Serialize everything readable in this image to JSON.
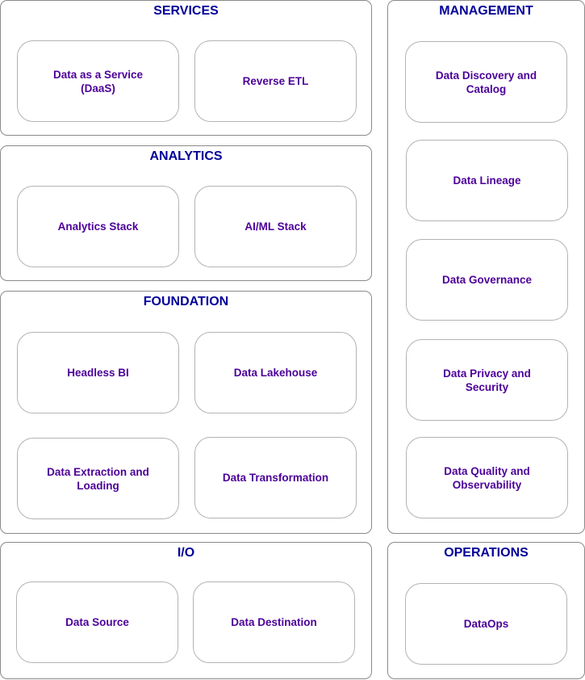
{
  "colors": {
    "group_title": "#000099",
    "card_text": "#4c0099",
    "group_border": "#8a8a8a",
    "card_border": "#b3b3b3"
  },
  "groups": {
    "services": {
      "title": "SERVICES",
      "items": [
        "Data as a Service\n(DaaS)",
        "Reverse ETL"
      ]
    },
    "analytics": {
      "title": "ANALYTICS",
      "items": [
        "Analytics Stack",
        "AI/ML Stack"
      ]
    },
    "foundation": {
      "title": "FOUNDATION",
      "items": [
        "Headless BI",
        "Data Lakehouse",
        "Data Extraction and\nLoading",
        "Data Transformation"
      ]
    },
    "io": {
      "title": "I/O",
      "items": [
        "Data Source",
        "Data Destination"
      ]
    },
    "management": {
      "title": "MANAGEMENT",
      "items": [
        "Data Discovery and\nCatalog",
        "Data Lineage",
        "Data Governance",
        "Data Privacy and\nSecurity",
        "Data Quality and\nObservability"
      ]
    },
    "operations": {
      "title": "OPERATIONS",
      "items": [
        "DataOps"
      ]
    }
  }
}
